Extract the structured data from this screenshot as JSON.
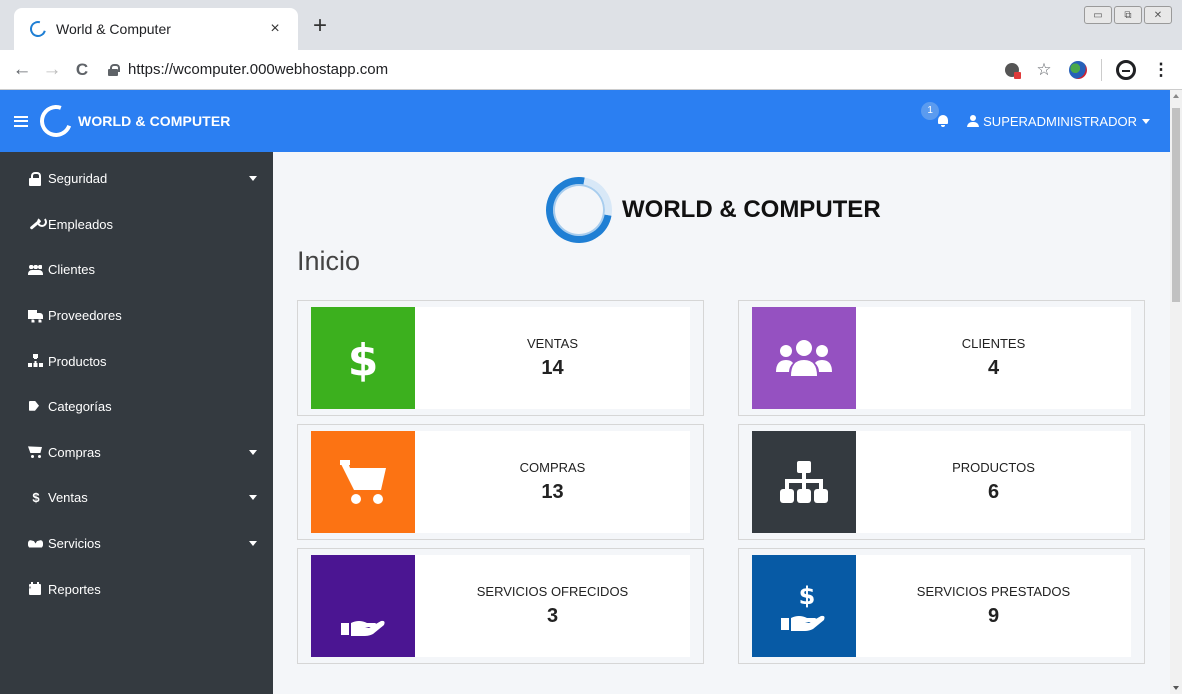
{
  "browser": {
    "tab_title": "World & Computer",
    "tab_close": "×",
    "new_tab": "+",
    "url": "https://wcomputer.000webhostapp.com",
    "back": "←",
    "forward": "→",
    "reload": "C",
    "star": "☆",
    "menu": "⋮",
    "window_controls": [
      "▭",
      "⧉",
      "✕"
    ]
  },
  "topnav": {
    "brand": "WORLD & COMPUTER",
    "notification_count": "1",
    "user": "SUPERADMINISTRADOR"
  },
  "sidebar": {
    "items": [
      {
        "label": "Seguridad",
        "icon": "lock-icon",
        "has_submenu": true
      },
      {
        "label": "Empleados",
        "icon": "wrench-icon",
        "has_submenu": false
      },
      {
        "label": "Clientes",
        "icon": "users-icon",
        "has_submenu": false
      },
      {
        "label": "Proveedores",
        "icon": "truck-icon",
        "has_submenu": false
      },
      {
        "label": "Productos",
        "icon": "sitemap-icon",
        "has_submenu": false
      },
      {
        "label": "Categorías",
        "icon": "tag-icon",
        "has_submenu": false
      },
      {
        "label": "Compras",
        "icon": "cart-icon",
        "has_submenu": true
      },
      {
        "label": "Ventas",
        "icon": "dollar-icon",
        "has_submenu": true
      },
      {
        "label": "Servicios",
        "icon": "handshake-icon",
        "has_submenu": true
      },
      {
        "label": "Reportes",
        "icon": "calendar-icon",
        "has_submenu": false
      }
    ]
  },
  "main": {
    "logo_text": "WORLD & COMPUTER",
    "title": "Inicio",
    "cards": [
      {
        "label": "VENTAS",
        "value": "14",
        "color": "#3cb01e",
        "icon": "dollar-icon"
      },
      {
        "label": "CLIENTES",
        "value": "4",
        "color": "#9551c1",
        "icon": "users-icon"
      },
      {
        "label": "COMPRAS",
        "value": "13",
        "color": "#fc7313",
        "icon": "cart-icon"
      },
      {
        "label": "PRODUCTOS",
        "value": "6",
        "color": "#343a40",
        "icon": "sitemap-icon"
      },
      {
        "label": "SERVICIOS OFRECIDOS",
        "value": "3",
        "color": "#4b1592",
        "icon": "hand-holding-icon"
      },
      {
        "label": "SERVICIOS PRESTADOS",
        "value": "9",
        "color": "#075aa5",
        "icon": "hand-holding-dollar-icon"
      }
    ]
  },
  "colors": {
    "topnav": "#2b7ff2",
    "sidebar": "#343a40",
    "content_bg": "#f4f6f9"
  }
}
